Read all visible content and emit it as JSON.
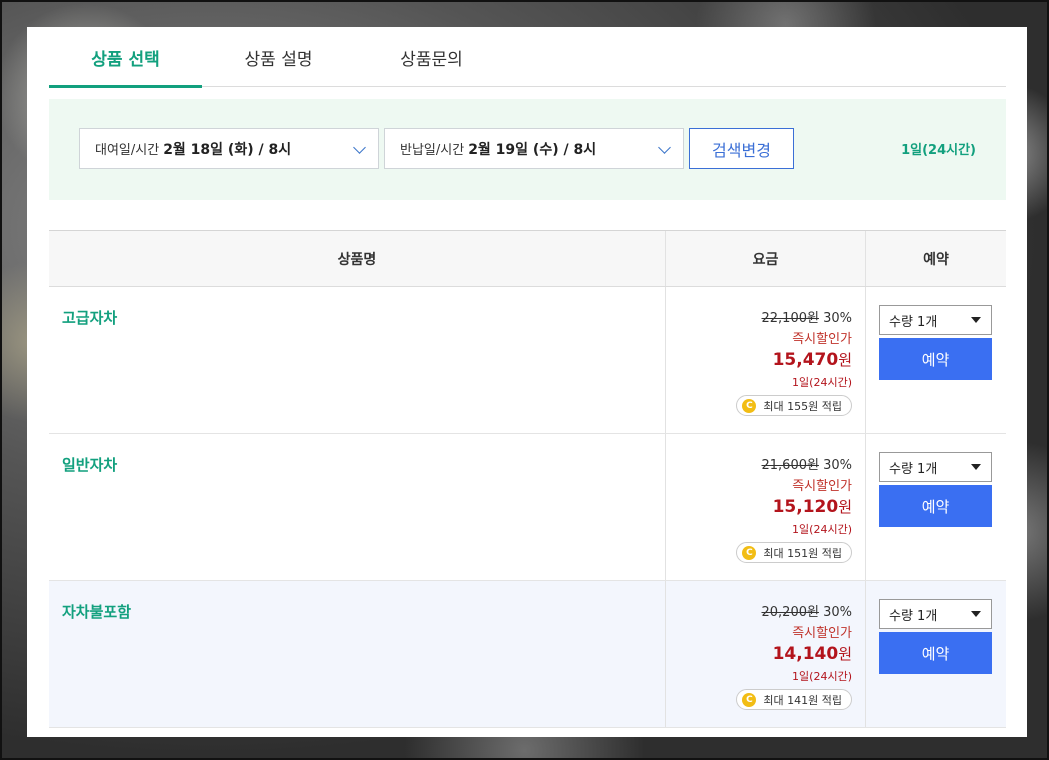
{
  "tabs": [
    {
      "label": "상품 선택",
      "active": true
    },
    {
      "label": "상품 설명",
      "active": false
    },
    {
      "label": "상품문의",
      "active": false
    }
  ],
  "search": {
    "rental_label": "대여일/시간",
    "rental_value": "2월 18일 (화) / 8시",
    "return_label": "반납일/시간",
    "return_value": "2월 19일 (수) / 8시",
    "button_label": "검색변경",
    "duration": "1일(24시간)"
  },
  "table": {
    "headers": {
      "name": "상품명",
      "price": "요금",
      "book": "예약"
    },
    "rows": [
      {
        "name": "고급자차",
        "original_price": "22,100원",
        "discount": "30%",
        "instant_label": "즉시할인가",
        "final_price": "15,470",
        "currency": "원",
        "period": "1일(24시간)",
        "points": "최대 155원 적립",
        "qty": "수량 1개",
        "book_label": "예약"
      },
      {
        "name": "일반자차",
        "original_price": "21,600원",
        "discount": "30%",
        "instant_label": "즉시할인가",
        "final_price": "15,120",
        "currency": "원",
        "period": "1일(24시간)",
        "points": "최대 151원 적립",
        "qty": "수량 1개",
        "book_label": "예약"
      },
      {
        "name": "자차불포함",
        "original_price": "20,200원",
        "discount": "30%",
        "instant_label": "즉시할인가",
        "final_price": "14,140",
        "currency": "원",
        "period": "1일(24시간)",
        "points": "최대 141원 적립",
        "qty": "수량 1개",
        "book_label": "예약"
      }
    ]
  },
  "icons": {
    "coin": "C",
    "coin_color": "#f2bd14"
  },
  "colors": {
    "accent_green": "#12a07e",
    "book_blue": "#3a6ff2",
    "price_red": "#b3141c"
  }
}
